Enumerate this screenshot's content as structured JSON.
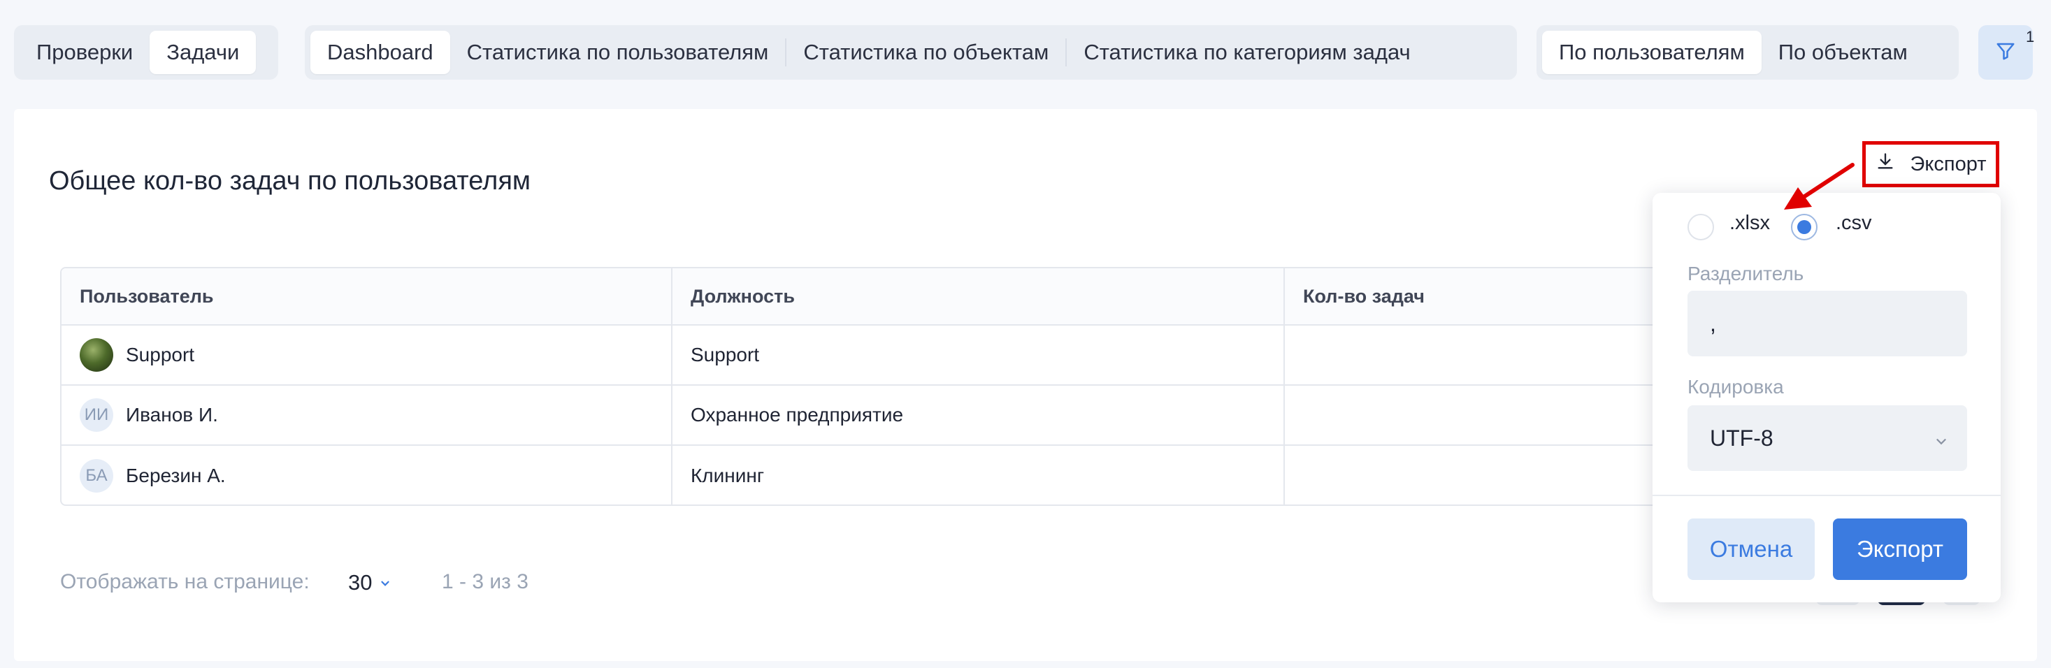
{
  "top_tabs": {
    "group1": [
      "Проверки",
      "Задачи"
    ],
    "group2": [
      "Dashboard",
      "Статистика по пользователям",
      "Статистика по объектам",
      "Статистика по категориям задач"
    ],
    "group3": [
      "По пользователям",
      "По объектам"
    ],
    "filter_badge": "1"
  },
  "card": {
    "title": "Общее кол-во задач по пользователям",
    "export_label": "Экспорт"
  },
  "table": {
    "columns": [
      "Пользователь",
      "Должность",
      "Кол-во задач"
    ],
    "rows": [
      {
        "initials": "",
        "name": "Support",
        "position": "Support"
      },
      {
        "initials": "ИИ",
        "name": "Иванов И.",
        "position": "Охранное предприятие"
      },
      {
        "initials": "БА",
        "name": "Березин А.",
        "position": "Клининг"
      }
    ]
  },
  "pagination": {
    "per_page_label": "Отображать на странице:",
    "per_page_value": "30",
    "range": "1 - 3 из 3"
  },
  "export_popover": {
    "formats": [
      ".xlsx",
      ".csv"
    ],
    "selected_format": ".csv",
    "separator_label": "Разделитель",
    "separator_value": ",",
    "encoding_label": "Кодировка",
    "encoding_value": "UTF-8",
    "cancel_label": "Отмена",
    "export_label": "Экспорт"
  },
  "colors": {
    "accent": "#3b7be0",
    "highlight": "#e00000"
  }
}
